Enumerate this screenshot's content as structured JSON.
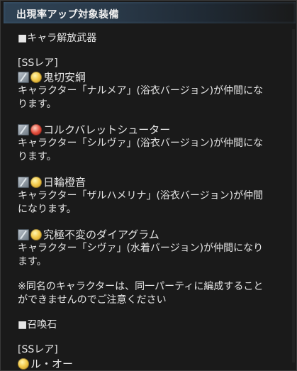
{
  "header": {
    "title": "出現率アップ対象装備"
  },
  "sections": [
    {
      "heading": "■キャラ解放武器",
      "rarity": "[SSレア]",
      "items": [
        {
          "name": "鬼切安綱",
          "desc_lines": [
            "キャラクター「ナルメア」(浴衣バージョン)が仲間にな",
            "ります。"
          ],
          "icons": [
            "sword-weapon-icon",
            "light-element-icon"
          ]
        },
        {
          "name": "コルクバレットシューター",
          "desc_lines": [
            "キャラクター「シルヴァ」(浴衣バージョン)が仲間にな",
            "ります。"
          ],
          "icons": [
            "gun-weapon-icon",
            "fire-element-icon"
          ]
        },
        {
          "name": "日輪橙音",
          "desc_lines": [
            "キャラクター「ザルハメリナ」(浴衣バージョン)が仲間",
            "になります。"
          ],
          "icons": [
            "instrument-weapon-icon",
            "light-element-icon"
          ]
        },
        {
          "name": "究極不変のダイアグラム",
          "desc_lines": [
            "キャラクター「シヴァ」(水着バージョン)が仲間になり",
            "ます。"
          ],
          "icons": [
            "staff-weapon-icon",
            "light-element-icon"
          ]
        }
      ],
      "note_lines": [
        "※同名のキャラクターは、同一パーティに編成すること",
        "ができませんのでご注意ください"
      ]
    },
    {
      "heading": "■召喚石",
      "rarity": "[SSレア]",
      "summon": {
        "name": "ル・オー",
        "icon": "light-element-icon"
      }
    }
  ],
  "colors": {
    "background": "#1a1a1a",
    "header_gradient_start": "#2f4355",
    "text": "#e6e6e6"
  }
}
